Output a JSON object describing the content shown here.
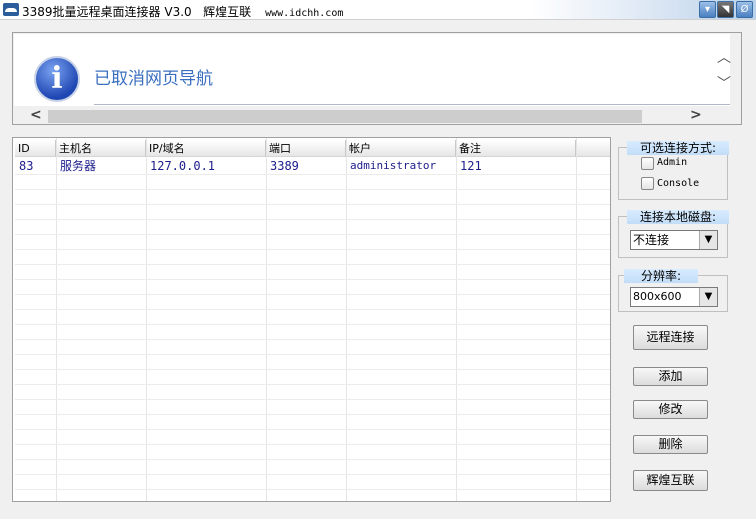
{
  "window": {
    "title": "3389批量远程桌面连接器 V3.0   辉煌互联",
    "site": "www.idchh.com"
  },
  "browser": {
    "message": "已取消网页导航"
  },
  "table": {
    "columns": [
      "ID",
      "主机名",
      "IP/域名",
      "端口",
      "帐户",
      "备注"
    ],
    "rows": [
      {
        "id": "83",
        "host": "服务器",
        "ip": "127.0.0.1",
        "port": "3389",
        "account": "administrator",
        "note": "121"
      }
    ]
  },
  "options": {
    "title": "可选连接方式:",
    "admin": "Admin",
    "console": "Console"
  },
  "disk": {
    "title": "连接本地磁盘:",
    "value": "不连接"
  },
  "resolution": {
    "title": "分辨率:",
    "value": "800x600"
  },
  "buttons": {
    "connect": "远程连接",
    "add": "添加",
    "edit": "修改",
    "delete": "删除",
    "brand": "辉煌互联"
  }
}
